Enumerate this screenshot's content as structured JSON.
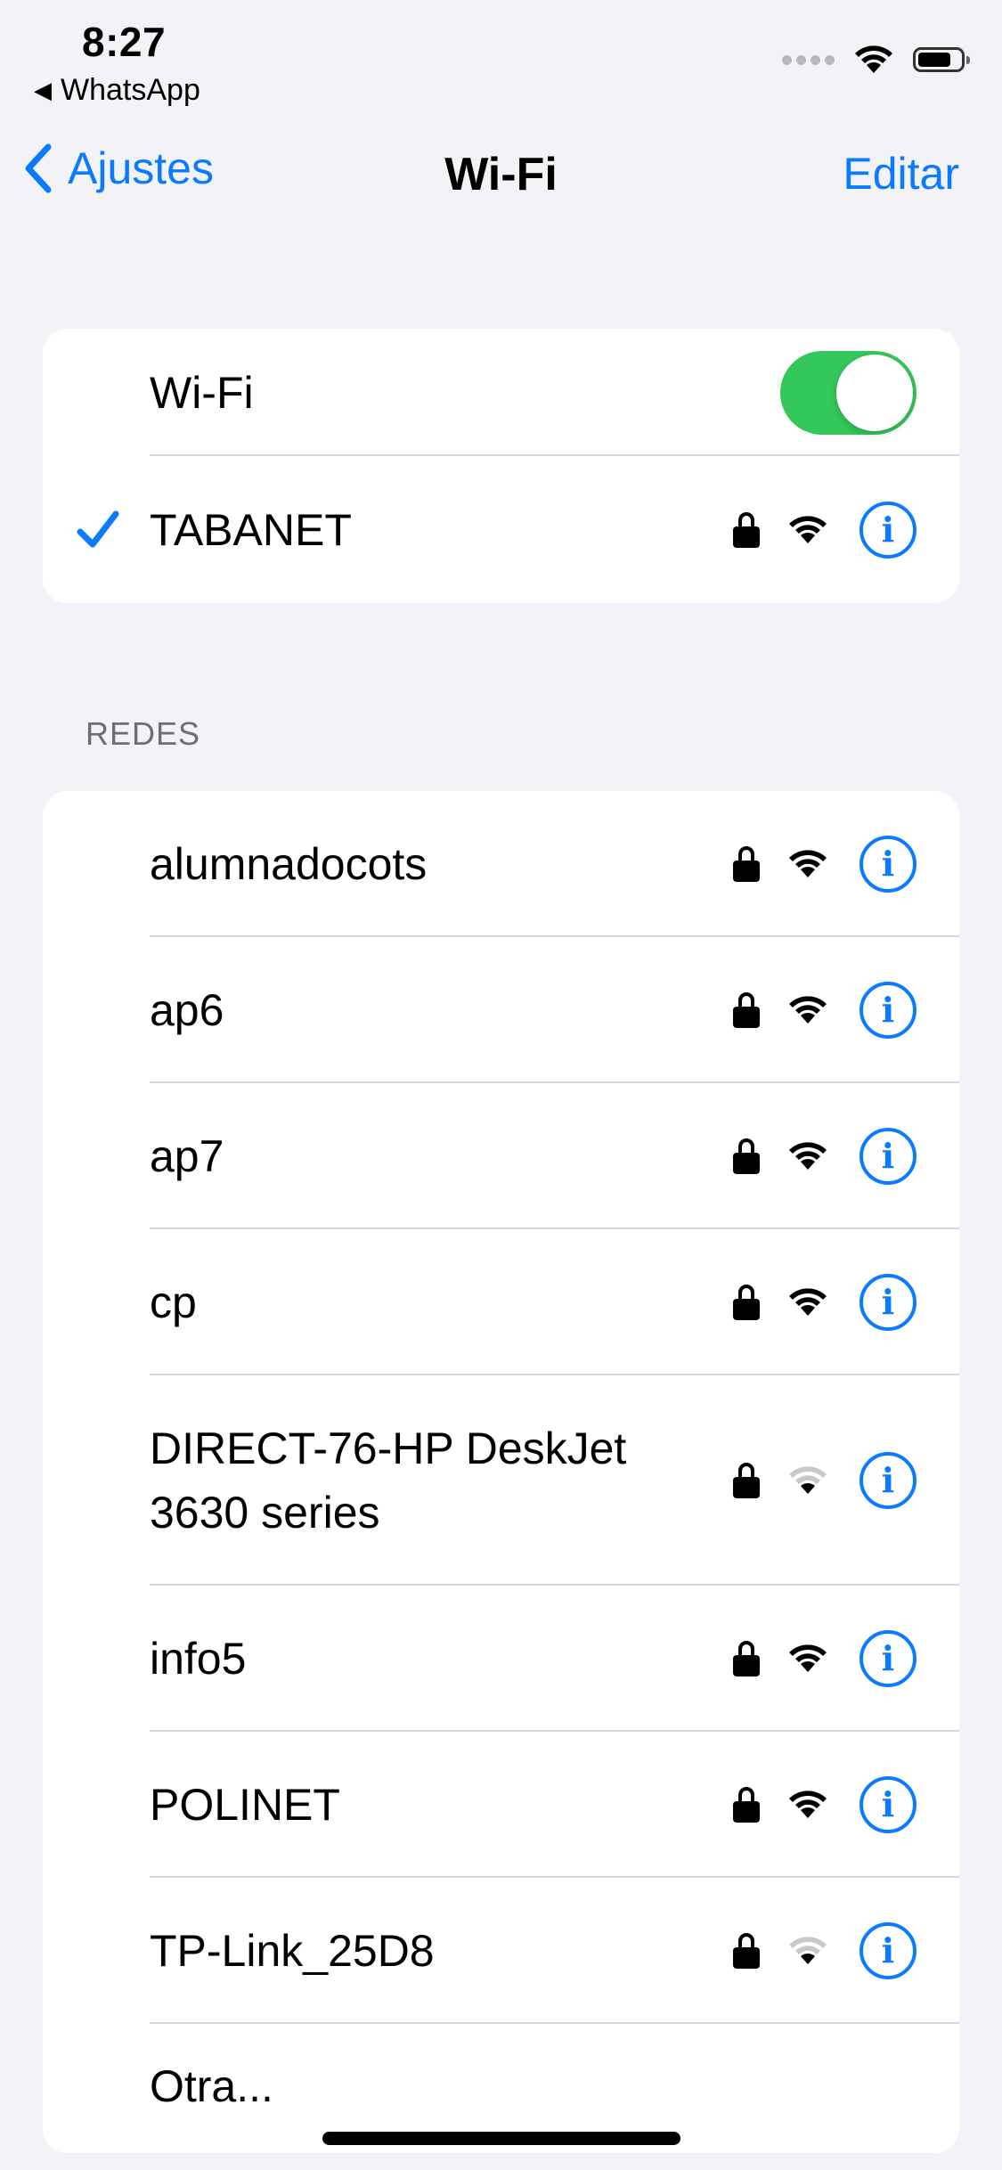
{
  "status_bar": {
    "time": "8:27",
    "back_app": "WhatsApp",
    "back_arrow": "◀",
    "icons": [
      "cellular-dots-icon",
      "wifi-signal-icon",
      "battery-icon"
    ]
  },
  "nav": {
    "back_label": "Ajustes",
    "title": "Wi-Fi",
    "edit_label": "Editar"
  },
  "wifi_card": {
    "label": "Wi-Fi",
    "enabled": true,
    "connected_network": "TABANET"
  },
  "section_header": "REDES",
  "networks": [
    {
      "name": "alumnadocots",
      "secured": true,
      "strong": true
    },
    {
      "name": "ap6",
      "secured": true,
      "strong": true
    },
    {
      "name": "ap7",
      "secured": true,
      "strong": true
    },
    {
      "name": "cp",
      "secured": true,
      "strong": true
    },
    {
      "name": "DIRECT-76-HP DeskJet 3630 series",
      "secured": true,
      "strong": false
    },
    {
      "name": "info5",
      "secured": true,
      "strong": true
    },
    {
      "name": "POLINET",
      "secured": true,
      "strong": true
    },
    {
      "name": "TP-Link_25D8",
      "secured": true,
      "strong": false
    }
  ],
  "other_label": "Otra...",
  "info_glyph": "i",
  "colors": {
    "accent": "#0a7aff",
    "toggle_on": "#34c759",
    "background": "#f2f2f7",
    "weak_signal": "#c7c7cc"
  }
}
